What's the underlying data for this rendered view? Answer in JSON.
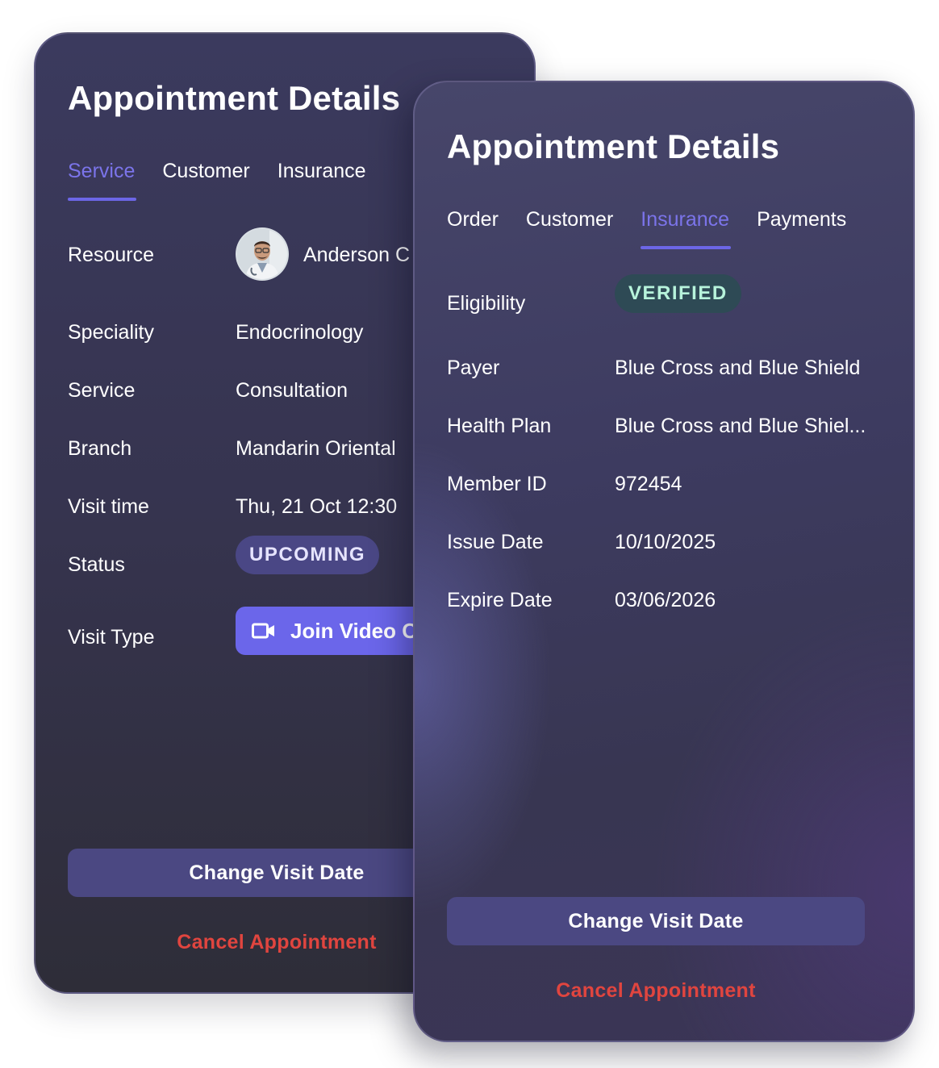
{
  "back_card": {
    "title": "Appointment Details",
    "tabs": [
      {
        "label": "Service",
        "active": true
      },
      {
        "label": "Customer",
        "active": false
      },
      {
        "label": "Insurance",
        "active": false
      }
    ],
    "fields": {
      "resource_label": "Resource",
      "resource_value": "Anderson C",
      "speciality_label": "Speciality",
      "speciality_value": "Endocrinology",
      "service_label": "Service",
      "service_value": "Consultation",
      "branch_label": "Branch",
      "branch_value": "Mandarin Oriental",
      "visit_time_label": "Visit time",
      "visit_time_value": "Thu, 21 Oct 12:30",
      "status_label": "Status",
      "status_value": "UPCOMING",
      "visit_type_label": "Visit Type",
      "visit_type_button": "Join Video C"
    },
    "change_visit_date": "Change Visit Date",
    "cancel_appointment": "Cancel Appointment"
  },
  "front_card": {
    "title": "Appointment Details",
    "tabs": [
      {
        "label": "Order",
        "active": false
      },
      {
        "label": "Customer",
        "active": false
      },
      {
        "label": "Insurance",
        "active": true
      },
      {
        "label": "Payments",
        "active": false
      }
    ],
    "fields": {
      "eligibility_label": "Eligibility",
      "eligibility_value": "VERIFIED",
      "payer_label": "Payer",
      "payer_value": "Blue Cross and Blue Shield",
      "health_plan_label": "Health Plan",
      "health_plan_value": "Blue Cross and Blue Shiel...",
      "member_id_label": "Member ID",
      "member_id_value": "972454",
      "issue_date_label": "Issue Date",
      "issue_date_value": "10/10/2025",
      "expire_date_label": "Expire Date",
      "expire_date_value": "03/06/2026"
    },
    "change_visit_date": "Change Visit Date",
    "cancel_appointment": "Cancel Appointment"
  },
  "colors": {
    "accent": "#6c66e6",
    "danger": "#e0453f",
    "verified_text": "#b7f3db",
    "upcoming_bg": "#4a4785"
  },
  "icons": [
    "doctor-avatar",
    "video-camera-icon"
  ]
}
